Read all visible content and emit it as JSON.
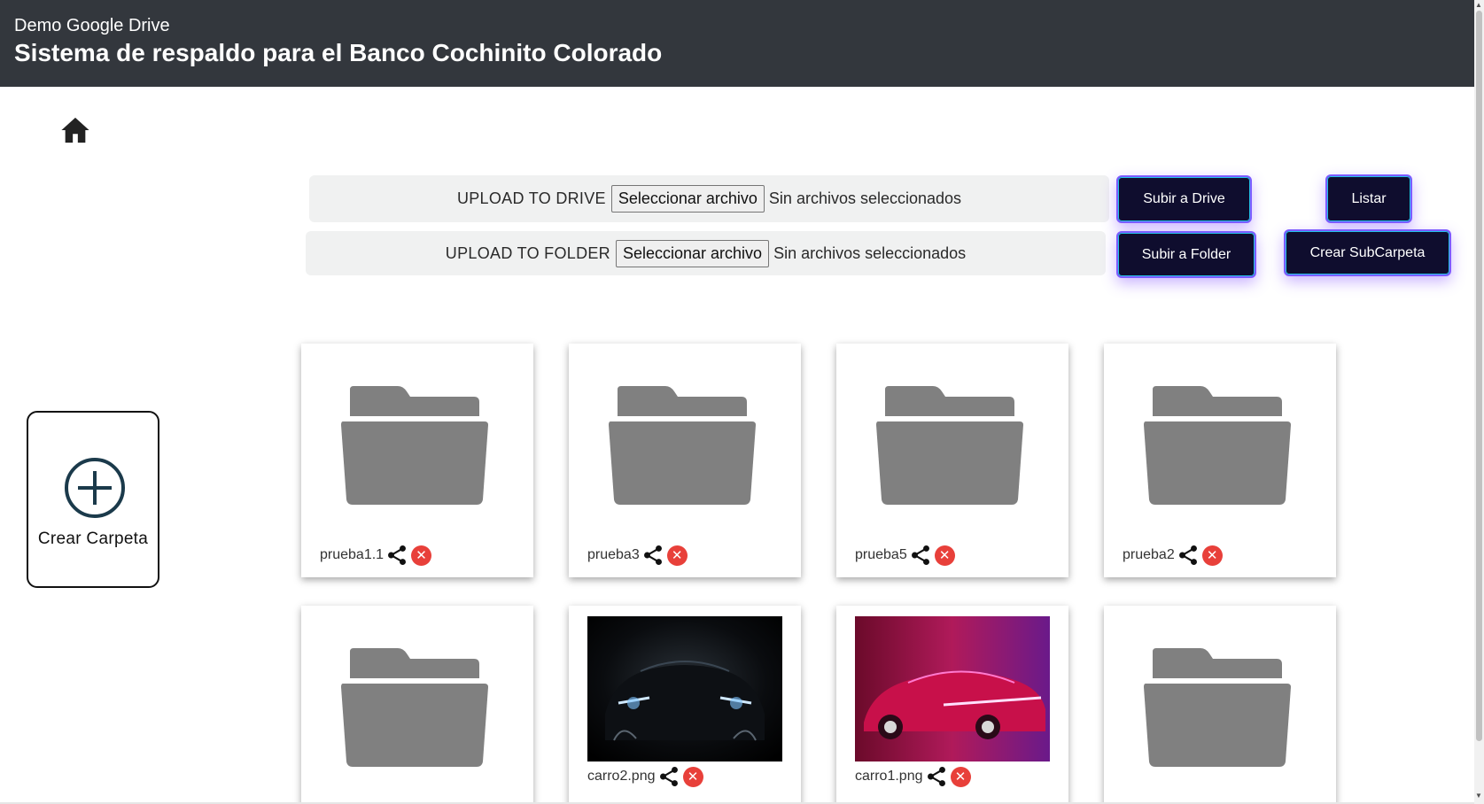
{
  "header": {
    "subtitle": "Demo Google Drive",
    "title": "Sistema de respaldo para el Banco Cochinito Colorado"
  },
  "nav": {
    "home_icon": "home-icon"
  },
  "upload": {
    "drive": {
      "label": "UPLOAD TO DRIVE",
      "file_button": "Seleccionar archivo",
      "status": "Sin archivos seleccionados"
    },
    "folder": {
      "label": "UPLOAD TO FOLDER",
      "file_button": "Seleccionar archivo",
      "status": "Sin archivos seleccionados"
    }
  },
  "buttons": {
    "subir_drive": "Subir a Drive",
    "listar": "Listar",
    "subir_folder": "Subir a Folder",
    "crear_subcarpeta": "Crear SubCarpeta"
  },
  "crear_carpeta": {
    "label": "Crear Carpeta",
    "icon": "plus-circle-icon"
  },
  "items": [
    {
      "name": "prueba1.1",
      "type": "folder"
    },
    {
      "name": "prueba3",
      "type": "folder"
    },
    {
      "name": "prueba5",
      "type": "folder"
    },
    {
      "name": "prueba2",
      "type": "folder"
    },
    {
      "name": "",
      "type": "folder"
    },
    {
      "name": "carro2.png",
      "type": "image"
    },
    {
      "name": "carro1.png",
      "type": "image"
    },
    {
      "name": "",
      "type": "folder"
    }
  ],
  "colors": {
    "header_bg": "#33373d",
    "button_bg": "#0f0d2e",
    "button_border": "#7d5cff",
    "folder_icon": "#808080",
    "delete_icon": "#e8403a"
  }
}
